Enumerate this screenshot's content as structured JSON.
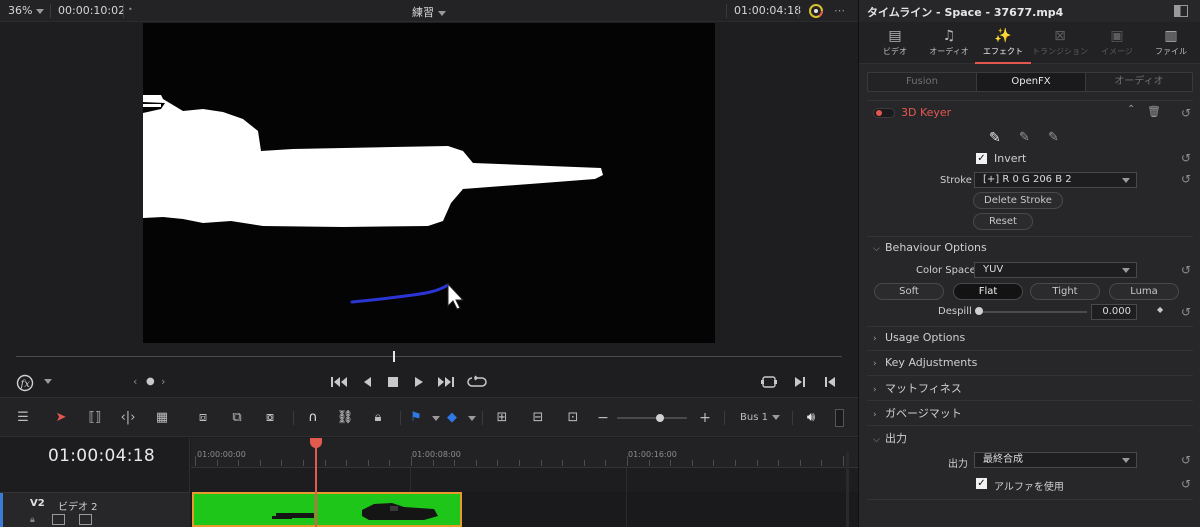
{
  "viewer": {
    "zoom": "36%",
    "source_timecode": "00:00:10:02",
    "clip_title": "練習",
    "record_timecode": "01:00:04:18"
  },
  "timeline_toolbar": {
    "bus": "Bus 1"
  },
  "timeline": {
    "timecode": "01:00:04:18",
    "ruler_labels": [
      "01:00:00:00",
      "01:00:08:00",
      "01:00:16:00"
    ],
    "track_id": "V2",
    "track_name": "ビデオ 2"
  },
  "inspector": {
    "title": "タイムライン - Space - 37677.mp4",
    "tabs": [
      {
        "label": "ビデオ",
        "icon": "video-icon",
        "state": "normal"
      },
      {
        "label": "オーディオ",
        "icon": "audio-icon",
        "state": "normal"
      },
      {
        "label": "エフェクト",
        "icon": "effects-wand-icon",
        "state": "active"
      },
      {
        "label": "トランジション",
        "icon": "transition-icon",
        "state": "disabled"
      },
      {
        "label": "イメージ",
        "icon": "image-icon",
        "state": "disabled"
      },
      {
        "label": "ファイル",
        "icon": "file-icon",
        "state": "normal"
      }
    ],
    "subtabs": [
      "Fusion",
      "OpenFX",
      "オーディオ"
    ],
    "active_subtab": "OpenFX",
    "effect_name": "3D Keyer",
    "invert_label": "Invert",
    "invert_checked": true,
    "stroke_label": "Stroke",
    "stroke_value": "[+]    R 0   G 206   B 2",
    "delete_stroke_label": "Delete Stroke",
    "reset_label": "Reset",
    "behaviour_options": "Behaviour Options",
    "color_space_label": "Color Space",
    "color_space_value": "YUV",
    "key_modes": [
      "Soft",
      "Flat",
      "Tight",
      "Luma"
    ],
    "selected_key_mode": "Flat",
    "despill_label": "Despill",
    "despill_value": "0.000",
    "collapsed_sections": [
      "Usage Options",
      "Key Adjustments",
      "マットフィネス",
      "ガベージマット"
    ],
    "output_section": "出力",
    "output_label": "出力",
    "output_value": "最終合成",
    "use_alpha_label": "アルファを使用",
    "use_alpha_checked": true
  },
  "colors": {
    "accent_red": "#e4574f",
    "clip_green": "#1ec61a",
    "clip_border": "#e89a2c",
    "stroke_blue": "#2b35d6"
  }
}
